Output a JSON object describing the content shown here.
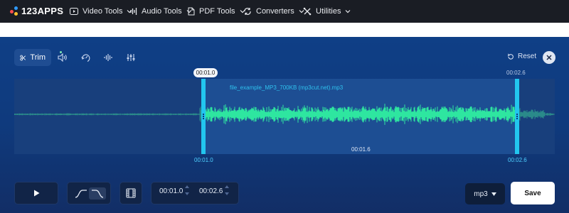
{
  "nav": {
    "logo_text": "123APPS",
    "items": [
      {
        "label": "Video Tools",
        "icon": "video-icon"
      },
      {
        "label": "Audio Tools",
        "icon": "audio-icon"
      },
      {
        "label": "PDF Tools",
        "icon": "pdf-icon"
      },
      {
        "label": "Converters",
        "icon": "converter-icon"
      },
      {
        "label": "Utilities",
        "icon": "utilities-icon"
      }
    ]
  },
  "toolbar": {
    "trim_label": "Trim",
    "tools": [
      "scissors-icon",
      "volume-icon",
      "speed-icon",
      "equalizer-icon",
      "mixer-icon"
    ]
  },
  "reset_label": "Reset",
  "waveform": {
    "filename": "file_example_MP3_700KB (mp3cut.net).mp3",
    "start_pill": "00:01.0",
    "end_top": "00:02.6",
    "center_time": "00:01.6",
    "start_bottom": "00:01.0",
    "end_bottom": "00:02.6",
    "selection_start": 0.35,
    "selection_end": 0.93
  },
  "controls": {
    "start_time": "00:01.0",
    "end_time": "00:02.6",
    "format": "mp3",
    "save_label": "Save"
  },
  "colors": {
    "wave": "#2ee6a0",
    "handle": "#22c6ef",
    "panel": "#1d4e93"
  }
}
